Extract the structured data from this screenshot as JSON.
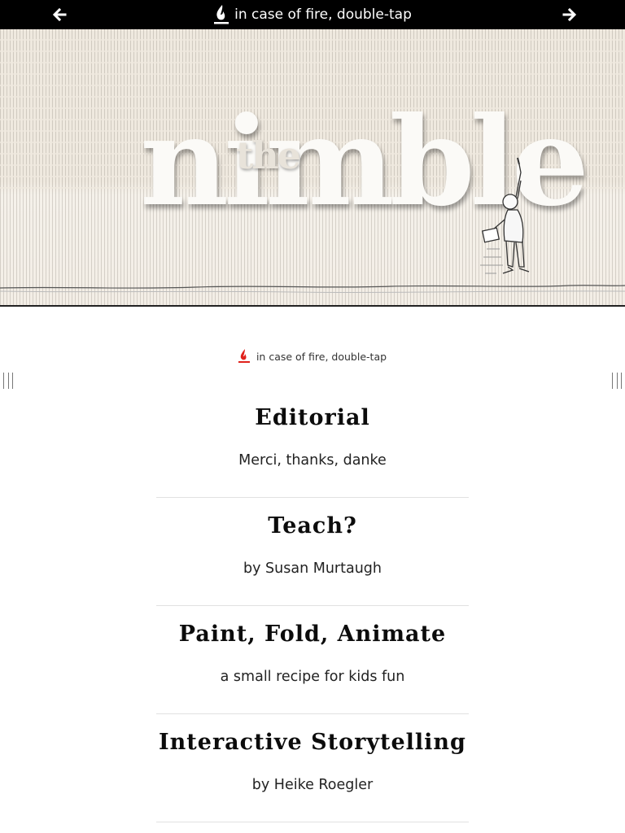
{
  "topbar": {
    "title": "in case of fire, double-tap",
    "prev_icon": "arrow-left-icon",
    "next_icon": "arrow-right-icon",
    "flame_icon": "flame-icon"
  },
  "banner": {
    "logo_the": "the",
    "logo_main": "nimble"
  },
  "subline": {
    "text": "in case of fire, double-tap",
    "flame_icon": "flame-icon",
    "flame_color": "#e0221c"
  },
  "articles": [
    {
      "title": "Editorial",
      "subtitle": "Merci, thanks, danke"
    },
    {
      "title": "Teach?",
      "subtitle": "by Susan Murtaugh"
    },
    {
      "title": "Paint, Fold, Animate",
      "subtitle": "a small recipe for kids fun"
    },
    {
      "title": "Interactive Storytelling",
      "subtitle": "by Heike Roegler"
    }
  ]
}
